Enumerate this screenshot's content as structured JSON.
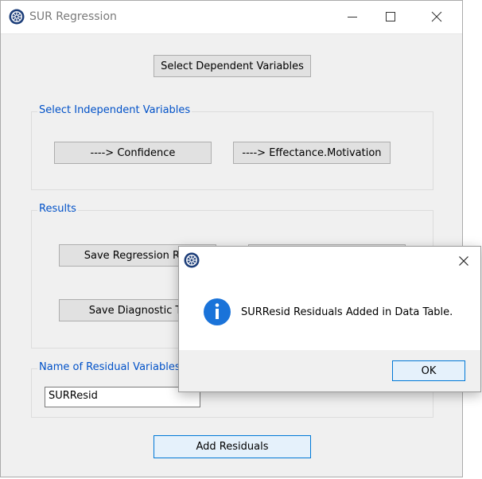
{
  "window": {
    "title": "SUR Regression"
  },
  "buttons": {
    "select_dependent": "Select Dependent Variables",
    "confidence": "----> Confidence",
    "effectance": "----> Effectance.Motivation",
    "save_regression": "Save Regression Res",
    "save_diagnostic": "Save Diagnostic Te",
    "add_residuals": "Add Residuals"
  },
  "groups": {
    "independent": "Select Independent Variables",
    "results": "Results",
    "residual_name": "Name of Residual Variables"
  },
  "residual_input": {
    "value": "SURResid"
  },
  "dialog": {
    "message": "SURResid Residuals Added in Data Table.",
    "ok_label": "OK"
  },
  "colors": {
    "accent": "#0078d7",
    "group_label": "#0051c8",
    "info_icon": "#1a73d9"
  },
  "icons": [
    "app-logo-icon",
    "minimize-icon",
    "maximize-icon",
    "close-icon",
    "info-icon"
  ]
}
